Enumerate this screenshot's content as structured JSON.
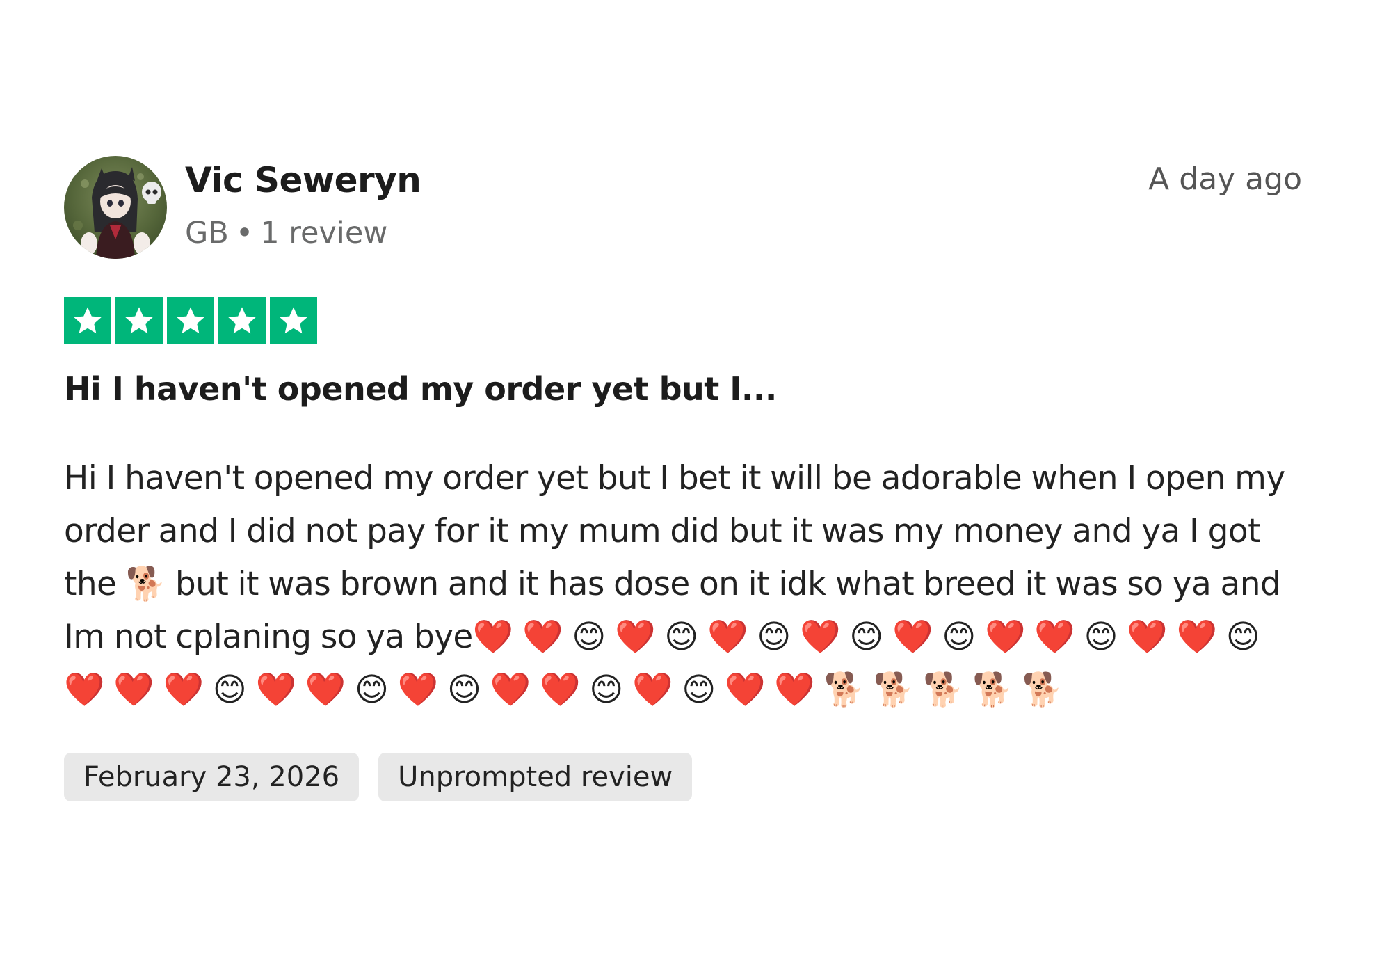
{
  "review": {
    "reviewer_name": "Vic Seweryn",
    "country": "GB",
    "separator": "•",
    "review_count": "1 review",
    "posted_relative": "A day ago",
    "rating": 5,
    "rating_max": 5,
    "title": "Hi I haven't opened my order yet but I...",
    "body": "Hi I haven't opened my order yet but I bet it will be adorable when I open my order and I did not pay for it my mum did but it was my money and ya I got the 🐕 but it was brown and it has dose on it idk what breed it was so ya and Im not cplaning so ya bye❤️ ❤️ 😊 ❤️ 😊 ❤️ 😊 ❤️ 😊 ❤️ 😊 ❤️ ❤️ 😊 ❤️ ❤️ 😊 ❤️ ❤️ ❤️ 😊 ❤️ ❤️ 😊 ❤️ 😊 ❤️ ❤️ 😊 ❤️ 😊 ❤️ ❤️ 🐕 🐕 🐕 🐕 🐕",
    "experience_date": "February 23, 2026",
    "review_type": "Unprompted review"
  },
  "colors": {
    "star_green": "#00b67a",
    "tag_background": "#e8e8e8",
    "meta_gray": "#696a6a"
  },
  "icons": {
    "avatar": "reviewer-avatar-photo",
    "star": "white-star-icon"
  }
}
